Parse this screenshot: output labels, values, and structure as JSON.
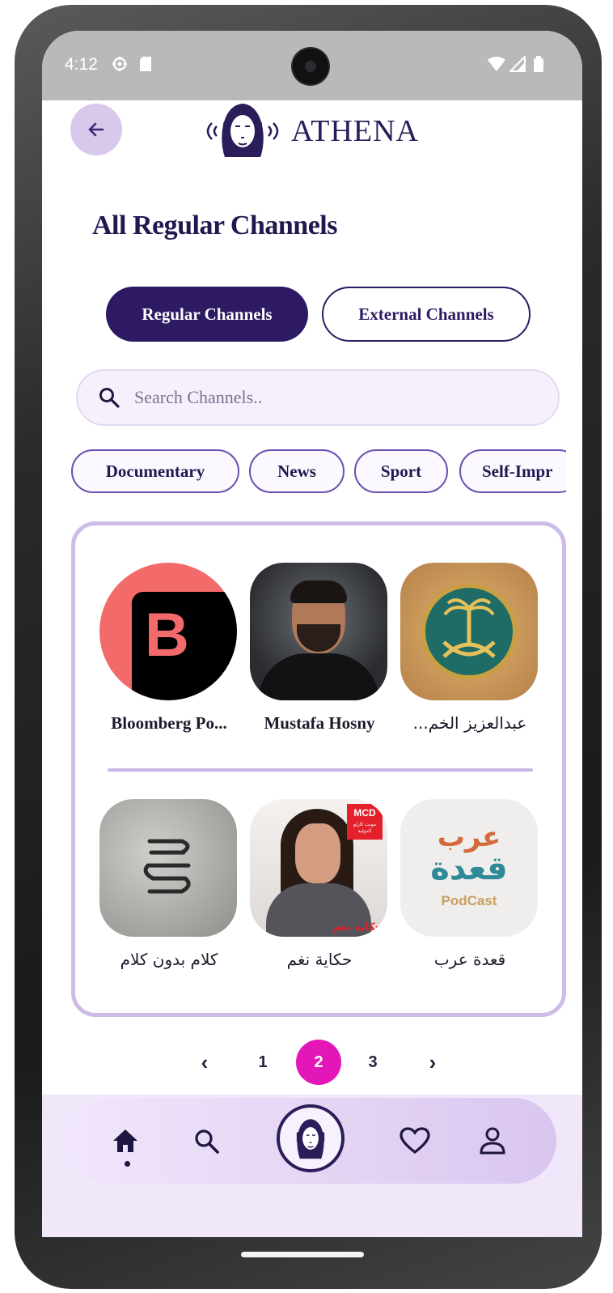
{
  "status_bar": {
    "time": "4:12",
    "left_icons": [
      "gear-icon",
      "sd-card-icon"
    ],
    "right_icons": [
      "wifi-icon",
      "signal-icon",
      "battery-icon"
    ]
  },
  "header": {
    "brand": "ATHENA"
  },
  "page": {
    "title": "All Regular Channels"
  },
  "tabs": [
    {
      "label": "Regular Channels",
      "active": true
    },
    {
      "label": "External Channels",
      "active": false
    }
  ],
  "search": {
    "placeholder": "Search Channels.."
  },
  "categories": [
    "Documentary",
    "News",
    "Sport",
    "Self-Impr"
  ],
  "channels_row1": [
    {
      "name": "Bloomberg Po...",
      "image": "bloomberg-logo"
    },
    {
      "name": "Mustafa Hosny",
      "image": "man-portrait"
    },
    {
      "name": "...عبدالعزيز الخم",
      "image": "saudi-emblem"
    }
  ],
  "channels_row2": [
    {
      "name": "كلام بدون كلام",
      "image": "calligraphy-logo"
    },
    {
      "name": "حكاية نغم",
      "image": "woman-portrait"
    },
    {
      "name": "قعدة عرب",
      "image": "qaadat-arab-podcast",
      "art_text": [
        "عرب",
        "قعدة",
        "PodCast"
      ]
    }
  ],
  "channel_art": {
    "mcd_badge": "MCD",
    "mcd_sub": "مونت كارلو الدولية",
    "naghm_caption": "حكاية نغم",
    "bloomberg_letter": "B"
  },
  "pagination": {
    "prev": "‹",
    "pages": [
      "1",
      "2",
      "3"
    ],
    "current": "2",
    "next": "›"
  },
  "bottom_nav": [
    "home-icon",
    "search-icon",
    "athena-logo-icon",
    "heart-icon",
    "profile-icon"
  ],
  "colors": {
    "primary": "#2d1a63",
    "accent": "#e316b8",
    "lavender": "#cdbce7"
  }
}
